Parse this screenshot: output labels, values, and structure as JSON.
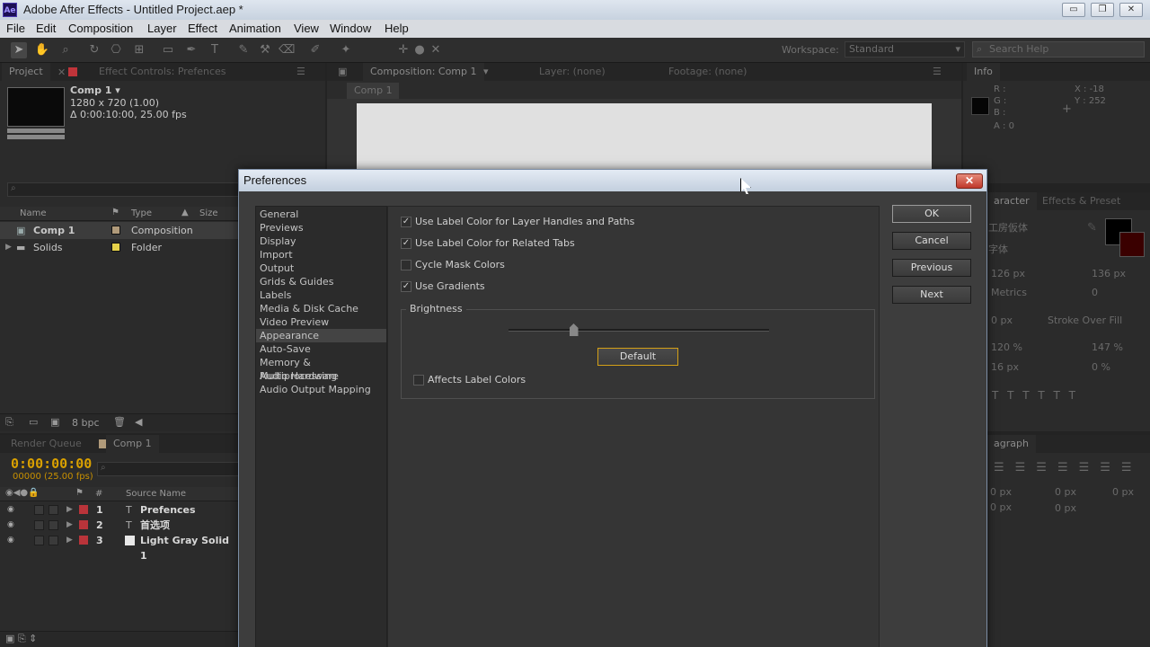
{
  "window": {
    "title": "Adobe After Effects - Untitled Project.aep *",
    "app_icon": "Ae",
    "minimize": "▭",
    "restore": "❐",
    "close": "✕"
  },
  "menu": [
    "File",
    "Edit",
    "Composition",
    "Layer",
    "Effect",
    "Animation",
    "View",
    "Window",
    "Help"
  ],
  "toolbar": {
    "workspace_label": "Workspace:",
    "workspace_value": "Standard",
    "search_placeholder": "Search Help"
  },
  "project_panel": {
    "tabs": [
      "Project",
      "Effect Controls: Prefences"
    ],
    "comp_name": "Comp 1 ▾",
    "comp_res": "1280 x 720 (1.00)",
    "comp_dur": "Δ 0:00:10:00, 25.00 fps",
    "headers": {
      "name": "Name",
      "type": "Type",
      "size": "Size"
    },
    "items": [
      {
        "name": "Comp 1",
        "type": "Composition",
        "color": "#b09a7a"
      },
      {
        "name": "Solids",
        "type": "Folder",
        "color": "#e6d24a"
      }
    ],
    "footer_bpc": "8 bpc"
  },
  "comp_panel": {
    "tabs": [
      "Composition: Comp 1",
      "Layer: (none)",
      "Footage: (none)"
    ],
    "subtab": "Comp 1"
  },
  "info_panel": {
    "tab": "Info",
    "r": "R :",
    "g": "G :",
    "b": "B :",
    "a": "A : 0",
    "x": "X : -18",
    "y": "Y : 252"
  },
  "character_panel": {
    "tabs": [
      "aracter",
      "Effects & Preset"
    ],
    "font": "工房仮体",
    "style": "字体",
    "size": "126 px",
    "leading": "136 px",
    "kerning": "Metrics",
    "tracking": "0",
    "stroke": "0 px",
    "stroke_mode": "Stroke Over Fill",
    "vscale": "120 %",
    "hscale": "147 %",
    "baseline": "16 px",
    "tsume": "0 %"
  },
  "paragraph_panel": {
    "tab": "agraph",
    "indent1": "0 px",
    "indent2": "0 px",
    "indent3": "0 px",
    "space1": "0 px",
    "space2": "0 px"
  },
  "timeline": {
    "tabs": [
      "Render Queue",
      "Comp 1"
    ],
    "timecode": "0:00:00:00",
    "fps": "00000 (25.00 fps)",
    "col_num": "#",
    "col_source": "Source Name",
    "layers": [
      {
        "num": "1",
        "name": "Prefences",
        "kind": "T"
      },
      {
        "num": "2",
        "name": "首选项",
        "kind": "T"
      },
      {
        "num": "3",
        "name": "Light Gray Solid 1",
        "kind": "solid"
      }
    ]
  },
  "preferences": {
    "title": "Preferences",
    "close": "✕",
    "categories": [
      "General",
      "Previews",
      "Display",
      "Import",
      "Output",
      "Grids & Guides",
      "Labels",
      "Media & Disk Cache",
      "Video Preview",
      "Appearance",
      "Auto-Save",
      "Memory & Multiprocessing",
      "Audio Hardware",
      "Audio Output Mapping"
    ],
    "selected_category": "Appearance",
    "options": [
      {
        "label": "Use Label Color for Layer Handles and Paths",
        "checked": "✓"
      },
      {
        "label": "Use Label Color for Related Tabs",
        "checked": "✓"
      },
      {
        "label": "Cycle Mask Colors",
        "checked": ""
      },
      {
        "label": "Use Gradients",
        "checked": "✓"
      }
    ],
    "brightness_label": "Brightness",
    "brightness_level": 0.25,
    "default_button": "Default",
    "affects_label": "Affects Label Colors",
    "affects_checked": "",
    "buttons": {
      "ok": "OK",
      "cancel": "Cancel",
      "previous": "Previous",
      "next": "Next"
    }
  }
}
